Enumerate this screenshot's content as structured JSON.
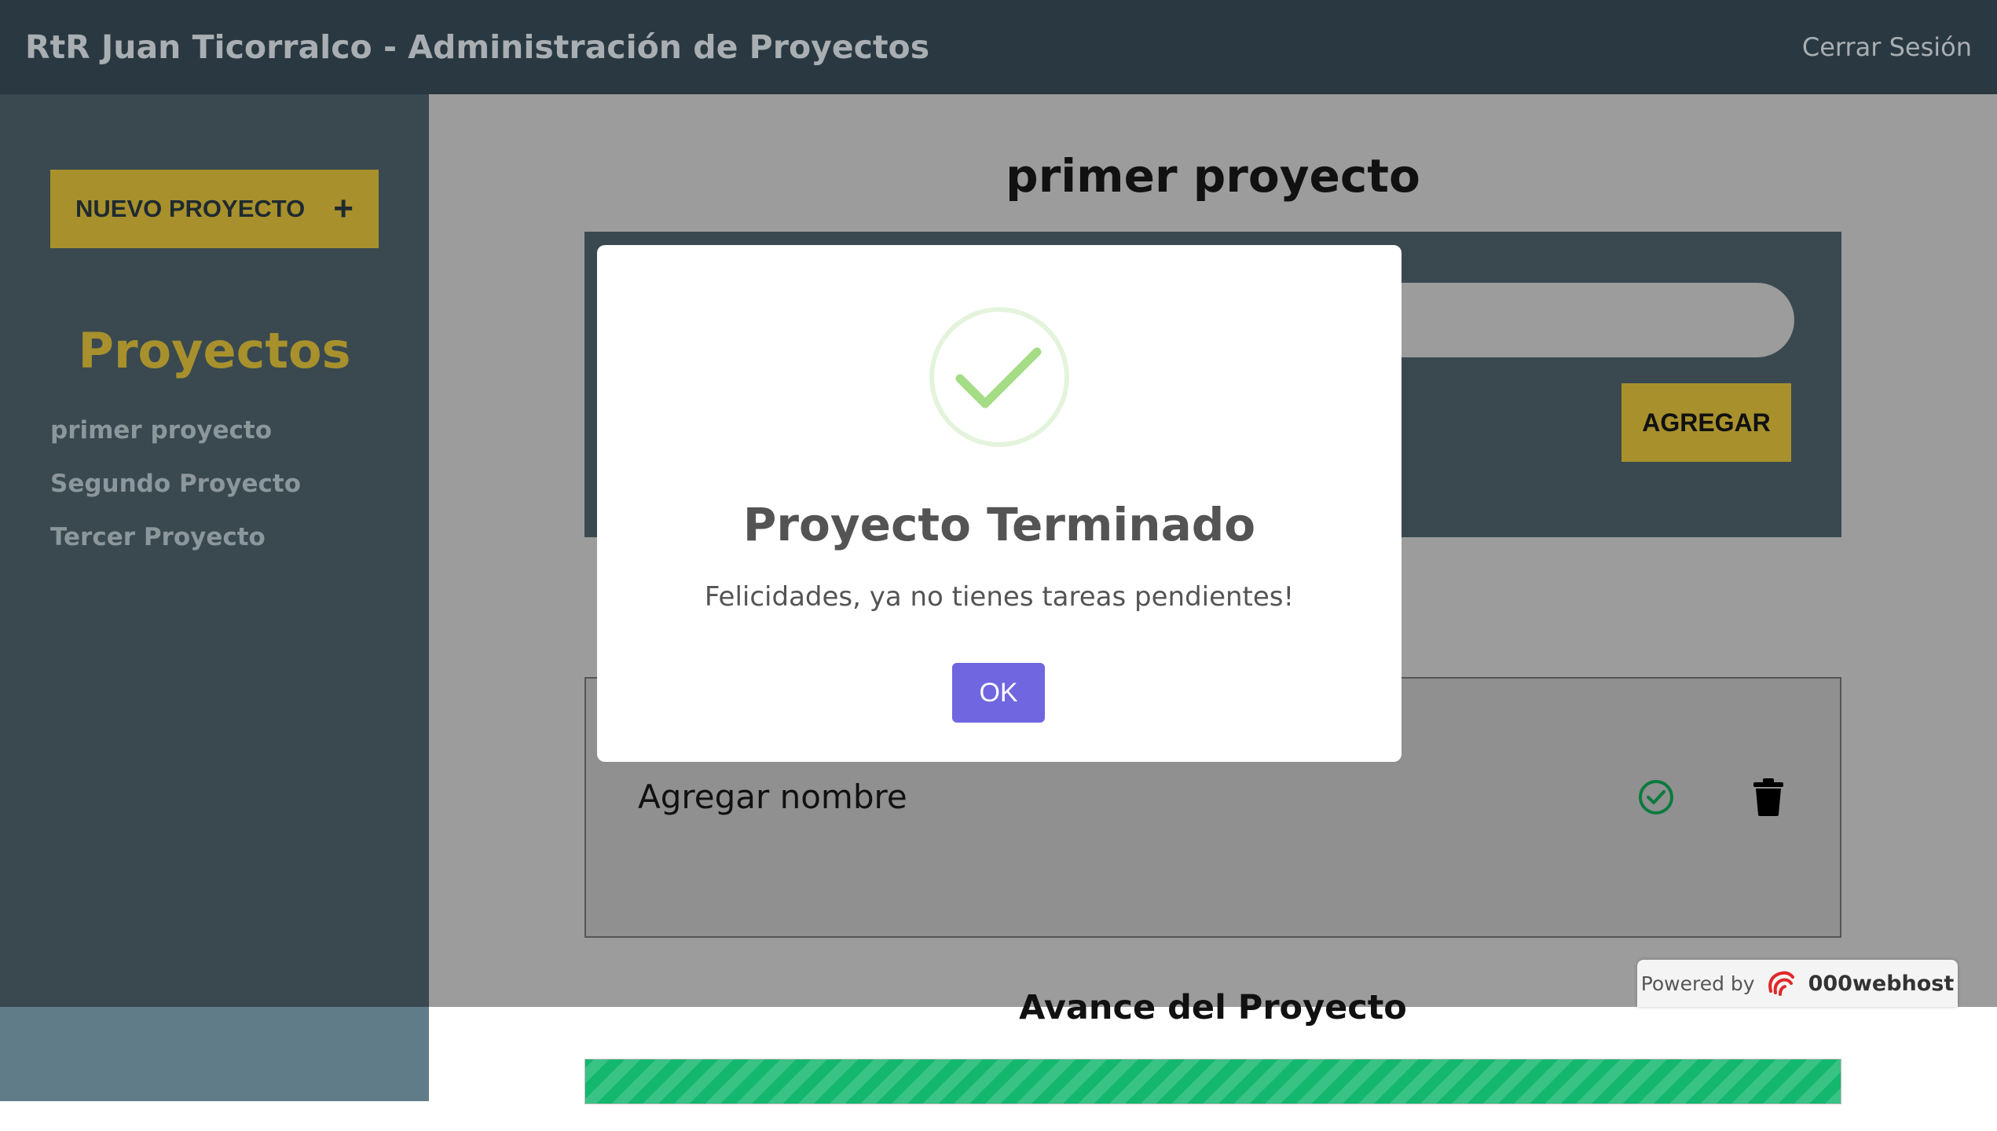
{
  "header": {
    "title": "RtR Juan Ticorralco - Administración de Proyectos",
    "logout_label": "Cerrar Sesión"
  },
  "sidebar": {
    "new_project_label": "NUEVO PROYECTO",
    "new_project_icon": "plus-icon",
    "heading": "Proyectos",
    "projects": [
      {
        "label": "primer proyecto"
      },
      {
        "label": "Segundo Proyecto"
      },
      {
        "label": "Tercer Proyecto"
      }
    ]
  },
  "main": {
    "project_title": "primer proyecto",
    "form": {
      "task_input_value": "",
      "add_button_label": "AGREGAR"
    },
    "tasks": [
      {
        "name": "Agregar nombre",
        "complete_icon": "check-circle-icon",
        "delete_icon": "trash-icon"
      }
    ]
  },
  "progress": {
    "title": "Avance del Proyecto",
    "percent": 100
  },
  "powered_by": {
    "prefix": "Powered by",
    "brand": "000webhost"
  },
  "modal": {
    "icon": "success-check-icon",
    "title": "Proyecto Terminado",
    "text": "Felicidades, ya no tienes tareas pendientes!",
    "ok_label": "OK"
  },
  "colors": {
    "header_bg": "#2a3841",
    "sidebar_bg": "#3a4950",
    "accent": "#a8912c",
    "progress": "#13b76e",
    "ok_button": "#7066e0",
    "complete_icon": "#0a7a3e"
  }
}
